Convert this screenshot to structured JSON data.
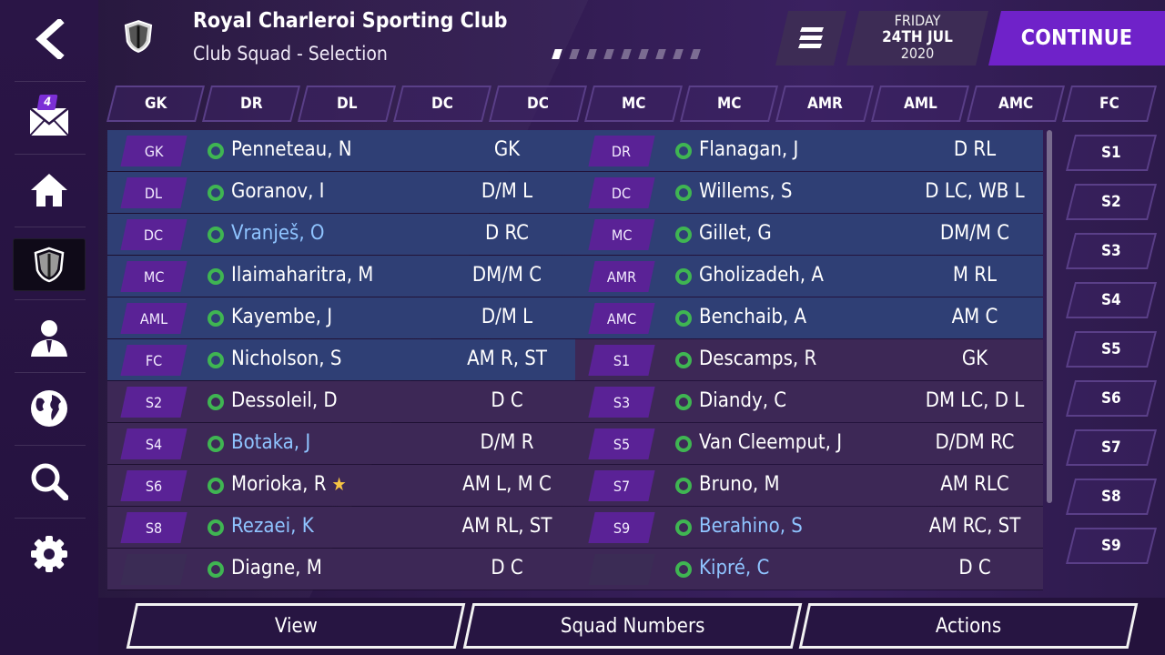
{
  "header": {
    "club_name": "Royal Charleroi Sporting Club",
    "subtitle": "Club Squad - Selection",
    "page_dots_total": 9,
    "page_dots_active": 1,
    "date_day": "FRIDAY",
    "date_main": "24TH JUL",
    "date_year": "2020",
    "continue_label": "CONTINUE"
  },
  "sidebar": {
    "inbox_badge": "4",
    "items": [
      "back-arrow-icon",
      "mail-icon",
      "home-icon",
      "shield-icon",
      "person-icon",
      "globe-icon",
      "search-icon",
      "gear-icon"
    ]
  },
  "formation": [
    "GK",
    "DR",
    "DL",
    "DC",
    "DC",
    "MC",
    "MC",
    "AMR",
    "AML",
    "AMC",
    "FC"
  ],
  "subs": [
    "S1",
    "S2",
    "S3",
    "S4",
    "S5",
    "S6",
    "S7",
    "S8",
    "S9"
  ],
  "rows": [
    {
      "left": {
        "slot": "GK",
        "name": "Penneteau, N",
        "pos": "GK",
        "type": "sel",
        "hl": false
      },
      "right": {
        "slot": "DR",
        "name": "Flanagan, J",
        "pos": "D RL",
        "type": "sel",
        "hl": false
      }
    },
    {
      "left": {
        "slot": "DL",
        "name": "Goranov, I",
        "pos": "D/M L",
        "type": "sel",
        "hl": false
      },
      "right": {
        "slot": "DC",
        "name": "Willems, S",
        "pos": "D LC, WB L",
        "type": "sel",
        "hl": false
      }
    },
    {
      "left": {
        "slot": "DC",
        "name": "Vranješ, O",
        "pos": "D RC",
        "type": "sel",
        "hl": true
      },
      "right": {
        "slot": "MC",
        "name": "Gillet, G",
        "pos": "DM/M C",
        "type": "sel",
        "hl": false
      }
    },
    {
      "left": {
        "slot": "MC",
        "name": "Ilaimaharitra, M",
        "pos": "DM/M C",
        "type": "sel",
        "hl": false
      },
      "right": {
        "slot": "AMR",
        "name": "Gholizadeh, A",
        "pos": "M RL",
        "type": "sel",
        "hl": false
      }
    },
    {
      "left": {
        "slot": "AML",
        "name": "Kayembe, J",
        "pos": "D/M L",
        "type": "sel",
        "hl": false
      },
      "right": {
        "slot": "AMC",
        "name": "Benchaib, A",
        "pos": "AM C",
        "type": "sel",
        "hl": false
      }
    },
    {
      "left": {
        "slot": "FC",
        "name": "Nicholson, S",
        "pos": "AM R, ST",
        "type": "sel",
        "hl": false
      },
      "right": {
        "slot": "S1",
        "name": "Descamps, R",
        "pos": "GK",
        "type": "res",
        "hl": false
      }
    },
    {
      "left": {
        "slot": "S2",
        "name": "Dessoleil, D",
        "pos": "D C",
        "type": "res",
        "hl": false
      },
      "right": {
        "slot": "S3",
        "name": "Diandy, C",
        "pos": "DM LC, D L",
        "type": "res",
        "hl": false
      }
    },
    {
      "left": {
        "slot": "S4",
        "name": "Botaka, J",
        "pos": "D/M R",
        "type": "res",
        "hl": true
      },
      "right": {
        "slot": "S5",
        "name": "Van Cleemput, J",
        "pos": "D/DM RC",
        "type": "res",
        "hl": false
      }
    },
    {
      "left": {
        "slot": "S6",
        "name": "Morioka, R",
        "pos": "AM L, M C",
        "type": "res",
        "hl": false,
        "star": true
      },
      "right": {
        "slot": "S7",
        "name": "Bruno, M",
        "pos": "AM RLC",
        "type": "res",
        "hl": false
      }
    },
    {
      "left": {
        "slot": "S8",
        "name": "Rezaei, K",
        "pos": "AM RL, ST",
        "type": "res",
        "hl": true
      },
      "right": {
        "slot": "S9",
        "name": "Berahino, S",
        "pos": "AM RC, ST",
        "type": "res",
        "hl": true
      }
    },
    {
      "left": {
        "slot": "",
        "name": "Diagne, M",
        "pos": "D C",
        "type": "res",
        "hl": false
      },
      "right": {
        "slot": "",
        "name": "Kipré, C",
        "pos": "D C",
        "type": "res",
        "hl": true
      }
    }
  ],
  "bottom": {
    "view_label": "View",
    "squad_numbers_label": "Squad Numbers",
    "actions_label": "Actions"
  },
  "colors": {
    "accent": "#6f22c9",
    "selected_row": "#2f3f75",
    "reserve_row": "#3d2856",
    "status_ok": "#3fb552",
    "highlight_name": "#8fc4ff"
  }
}
